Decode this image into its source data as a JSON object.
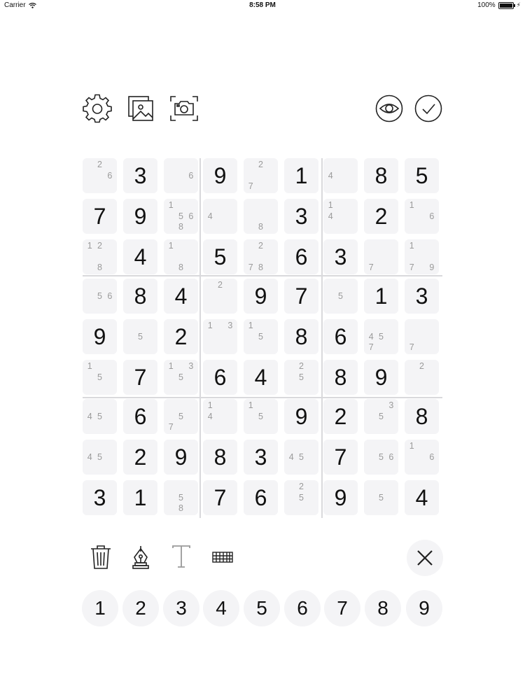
{
  "status_bar": {
    "carrier": "Carrier",
    "time": "8:58 PM",
    "battery": "100%"
  },
  "toolbar": {
    "left": [
      {
        "name": "settings-button",
        "icon": "gear-icon"
      },
      {
        "name": "gallery-button",
        "icon": "image-gallery-icon"
      },
      {
        "name": "camera-button",
        "icon": "camera-scan-icon"
      }
    ],
    "right": [
      {
        "name": "reveal-button",
        "icon": "eye-icon"
      },
      {
        "name": "check-button",
        "icon": "checkmark-icon"
      }
    ]
  },
  "board": {
    "rows": [
      [
        {
          "n": [
            2,
            6
          ]
        },
        {
          "v": "3"
        },
        {
          "n": [
            6
          ]
        },
        {
          "v": "9"
        },
        {
          "n": [
            2,
            7
          ]
        },
        {
          "v": "1"
        },
        {
          "n": [
            4
          ]
        },
        {
          "v": "8"
        },
        {
          "v": "5"
        }
      ],
      [
        {
          "v": "7"
        },
        {
          "v": "9"
        },
        {
          "n": [
            1,
            5,
            6,
            8
          ]
        },
        {
          "n": [
            4
          ]
        },
        {
          "n": [
            8
          ]
        },
        {
          "v": "3"
        },
        {
          "n": [
            1,
            4
          ]
        },
        {
          "v": "2"
        },
        {
          "n": [
            1,
            6
          ]
        }
      ],
      [
        {
          "n": [
            1,
            2,
            8
          ]
        },
        {
          "v": "4"
        },
        {
          "n": [
            1,
            8
          ]
        },
        {
          "v": "5"
        },
        {
          "n": [
            2,
            7,
            8
          ]
        },
        {
          "v": "6"
        },
        {
          "v": "3"
        },
        {
          "n": [
            7
          ]
        },
        {
          "n": [
            1,
            7,
            9
          ]
        }
      ],
      [
        {
          "n": [
            5,
            6
          ]
        },
        {
          "v": "8"
        },
        {
          "v": "4"
        },
        {
          "n": [
            2
          ]
        },
        {
          "v": "9"
        },
        {
          "v": "7"
        },
        {
          "n": [
            5
          ]
        },
        {
          "v": "1"
        },
        {
          "v": "3"
        }
      ],
      [
        {
          "v": "9"
        },
        {
          "n": [
            5
          ]
        },
        {
          "v": "2"
        },
        {
          "n": [
            1,
            3
          ]
        },
        {
          "n": [
            1,
            5
          ]
        },
        {
          "v": "8"
        },
        {
          "v": "6"
        },
        {
          "n": [
            4,
            5,
            7
          ]
        },
        {
          "n": [
            7
          ]
        }
      ],
      [
        {
          "n": [
            1,
            5
          ]
        },
        {
          "v": "7"
        },
        {
          "n": [
            1,
            3,
            5
          ]
        },
        {
          "v": "6"
        },
        {
          "v": "4"
        },
        {
          "n": [
            2,
            5
          ]
        },
        {
          "v": "8"
        },
        {
          "v": "9"
        },
        {
          "n": [
            2
          ]
        }
      ],
      [
        {
          "n": [
            4,
            5
          ]
        },
        {
          "v": "6"
        },
        {
          "n": [
            5,
            7
          ]
        },
        {
          "n": [
            1,
            4
          ]
        },
        {
          "n": [
            1,
            5
          ]
        },
        {
          "v": "9"
        },
        {
          "v": "2"
        },
        {
          "n": [
            3,
            5
          ]
        },
        {
          "v": "8"
        }
      ],
      [
        {
          "n": [
            4,
            5
          ]
        },
        {
          "v": "2"
        },
        {
          "v": "9"
        },
        {
          "v": "8"
        },
        {
          "v": "3"
        },
        {
          "n": [
            4,
            5
          ]
        },
        {
          "v": "7"
        },
        {
          "n": [
            5,
            6
          ]
        },
        {
          "n": [
            1,
            6
          ]
        }
      ],
      [
        {
          "v": "3"
        },
        {
          "v": "1"
        },
        {
          "n": [
            5,
            8
          ]
        },
        {
          "v": "7"
        },
        {
          "v": "6"
        },
        {
          "n": [
            2,
            5
          ]
        },
        {
          "v": "9"
        },
        {
          "n": [
            5
          ]
        },
        {
          "v": "4"
        }
      ]
    ]
  },
  "tools": [
    {
      "name": "delete-button",
      "icon": "trash-icon"
    },
    {
      "name": "pen-button",
      "icon": "pen-icon"
    },
    {
      "name": "text-button",
      "icon": "text-icon"
    },
    {
      "name": "keyboard-button",
      "icon": "keyboard-icon"
    }
  ],
  "close_button": {
    "icon": "close-icon"
  },
  "number_pad": [
    "1",
    "2",
    "3",
    "4",
    "5",
    "6",
    "7",
    "8",
    "9"
  ]
}
